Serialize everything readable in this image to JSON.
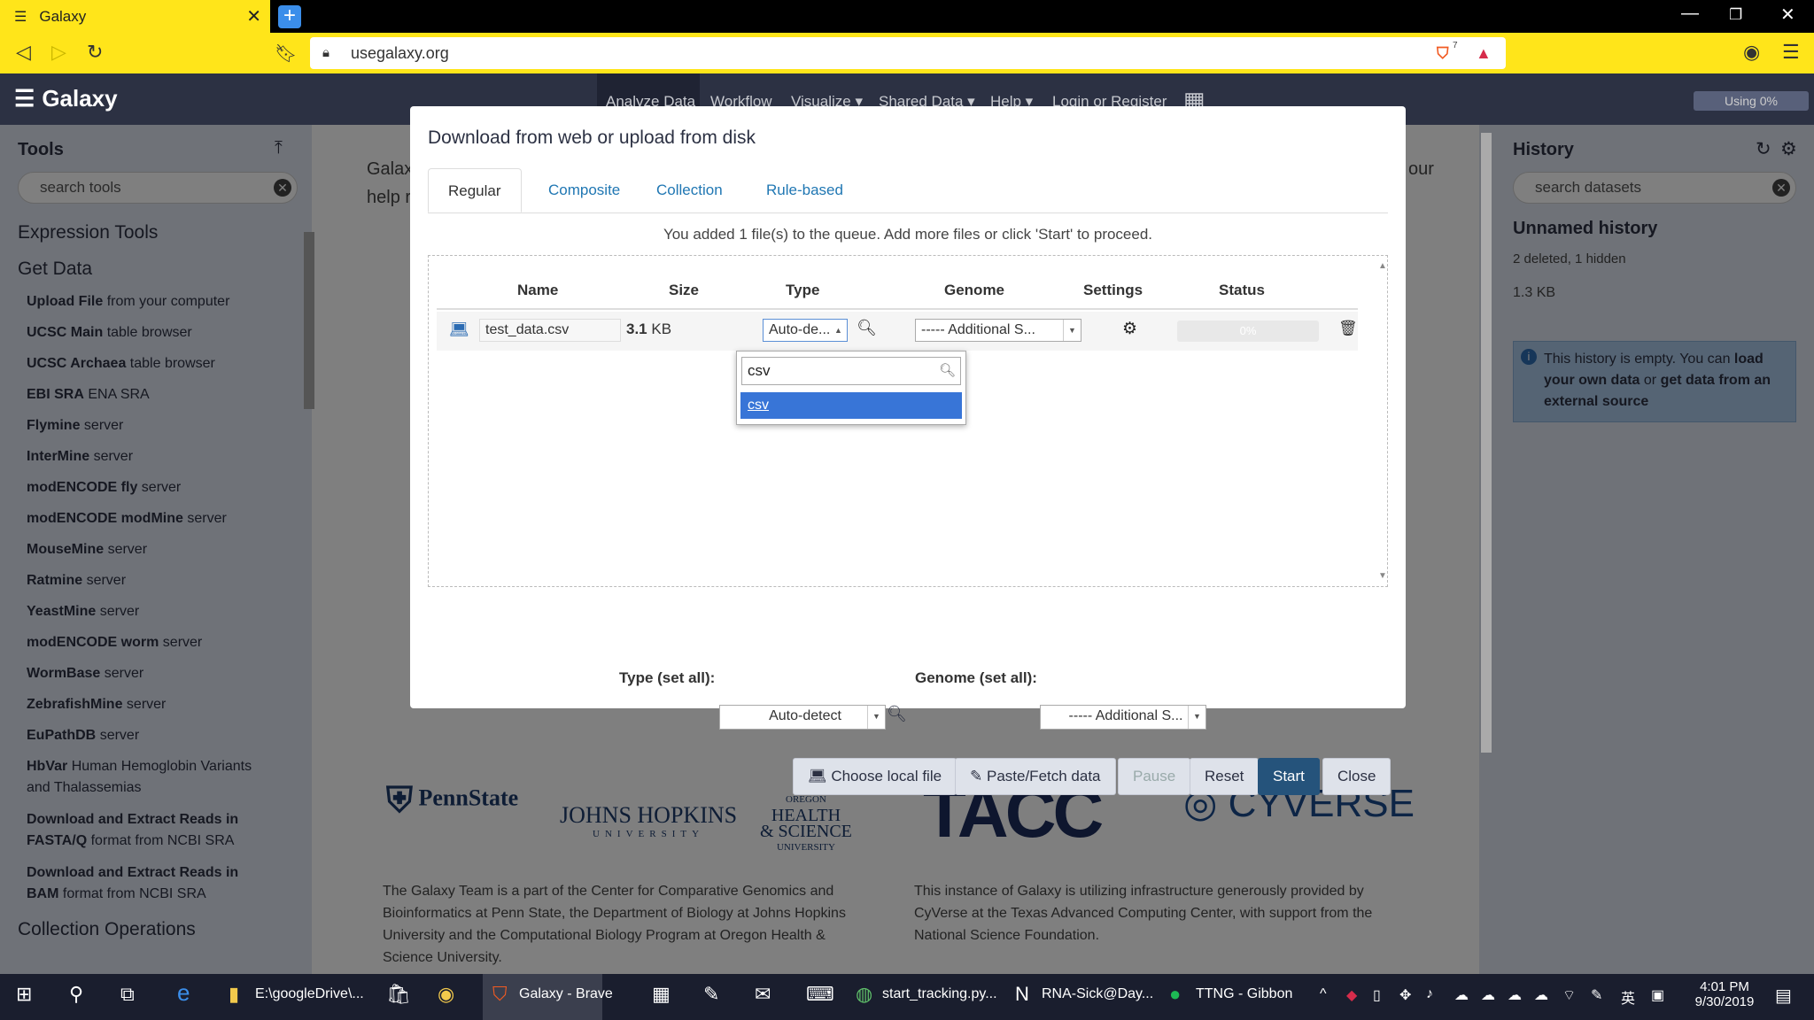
{
  "browser": {
    "tab_title": "Galaxy",
    "url": "usegalaxy.org",
    "shield_badge": "7"
  },
  "masthead": {
    "brand": "Galaxy",
    "nav": [
      "Analyze Data",
      "Workflow",
      "Visualize ▾",
      "Shared Data ▾",
      "Help ▾",
      "Login or Register"
    ],
    "usage": "Using 0%"
  },
  "tools": {
    "title": "Tools",
    "search_placeholder": "search tools",
    "sections": [
      "Expression Tools",
      "Get Data",
      "Collection Operations"
    ],
    "items": [
      {
        "name": "Upload File",
        "desc": "from your computer"
      },
      {
        "name": "UCSC Main",
        "desc": "table browser"
      },
      {
        "name": "UCSC Archaea",
        "desc": "table browser"
      },
      {
        "name": "EBI SRA",
        "desc": "ENA SRA"
      },
      {
        "name": "Flymine",
        "desc": "server"
      },
      {
        "name": "InterMine",
        "desc": "server"
      },
      {
        "name": "modENCODE fly",
        "desc": "server"
      },
      {
        "name": "modENCODE modMine",
        "desc": "server"
      },
      {
        "name": "MouseMine",
        "desc": "server"
      },
      {
        "name": "Ratmine",
        "desc": "server"
      },
      {
        "name": "YeastMine",
        "desc": "server"
      },
      {
        "name": "modENCODE worm",
        "desc": "server"
      },
      {
        "name": "WormBase",
        "desc": "server"
      },
      {
        "name": "ZebrafishMine",
        "desc": "server"
      },
      {
        "name": "EuPathDB",
        "desc": "server"
      }
    ],
    "hbvar_name": "HbVar",
    "hbvar_desc": "Human Hemoglobin Variants",
    "hbvar_desc2": "and Thalassemias",
    "sra1_name": "Download and Extract Reads in",
    "sra1_name2": "FASTA/Q",
    "sra1_desc": "format from NCBI SRA",
    "sra2_name": "Download and Extract Reads in",
    "sra2_name2": "BAM",
    "sra2_desc": "format from NCBI SRA"
  },
  "center": {
    "frag1": "Galax",
    "frag2": "help r",
    "frag3": "our"
  },
  "modal": {
    "title": "Download from web or upload from disk",
    "tabs": [
      "Regular",
      "Composite",
      "Collection",
      "Rule-based"
    ],
    "queue_msg": "You added 1 file(s) to the queue. Add more files or click 'Start' to proceed.",
    "columns": [
      "Name",
      "Size",
      "Type",
      "Genome",
      "Settings",
      "Status"
    ],
    "file": {
      "name": "test_data.csv",
      "size_num": "3.1",
      "size_unit": "KB",
      "type": "Auto-de...",
      "genome": "----- Additional S...",
      "progress": "0%"
    },
    "dropdown": {
      "search": "csv",
      "option": "csv"
    },
    "type_all_label": "Type (set all):",
    "type_all_value": "Auto-detect",
    "genome_all_label": "Genome (set all):",
    "genome_all_value": "----- Additional S...",
    "buttons": {
      "choose": "Choose local file",
      "paste": "Paste/Fetch data",
      "pause": "Pause",
      "reset": "Reset",
      "start": "Start",
      "close": "Close"
    }
  },
  "history": {
    "title": "History",
    "search_placeholder": "search datasets",
    "name": "Unnamed history",
    "counts": "2 deleted, 1 hidden",
    "size": "1.3 KB",
    "msg1": "This history is empty. You can ",
    "msg_link1": "load your own data",
    "msg2": " or ",
    "msg_link2": "get data from an external source"
  },
  "footer": {
    "logos": [
      "PennState",
      "JOHNS HOPKINS",
      "UNIVERSITY",
      "OREGON",
      "HEALTH",
      "& SCIENCE",
      "UNIVERSITY",
      "TACC",
      "CYVERSE"
    ],
    "left_text": [
      "The Galaxy Team is a part of the Center for Comparative Genomics and",
      "Bioinformatics at Penn State, the Department of Biology at Johns Hopkins",
      "University and the Computational Biology Program at Oregon Health &",
      "Science University."
    ],
    "right_text": [
      "This instance of Galaxy is utilizing infrastructure generously provided by",
      "CyVerse at the Texas Advanced Computing Center, with support from the",
      "National Science Foundation."
    ]
  },
  "taskbar": {
    "items": [
      "E:\\googleDrive\\...",
      "Galaxy - Brave",
      "start_tracking.py...",
      "RNA-Sick@Day...",
      "TTNG - Gibbon"
    ],
    "time": "4:01 PM",
    "date": "9/30/2019",
    "lang": "英"
  }
}
